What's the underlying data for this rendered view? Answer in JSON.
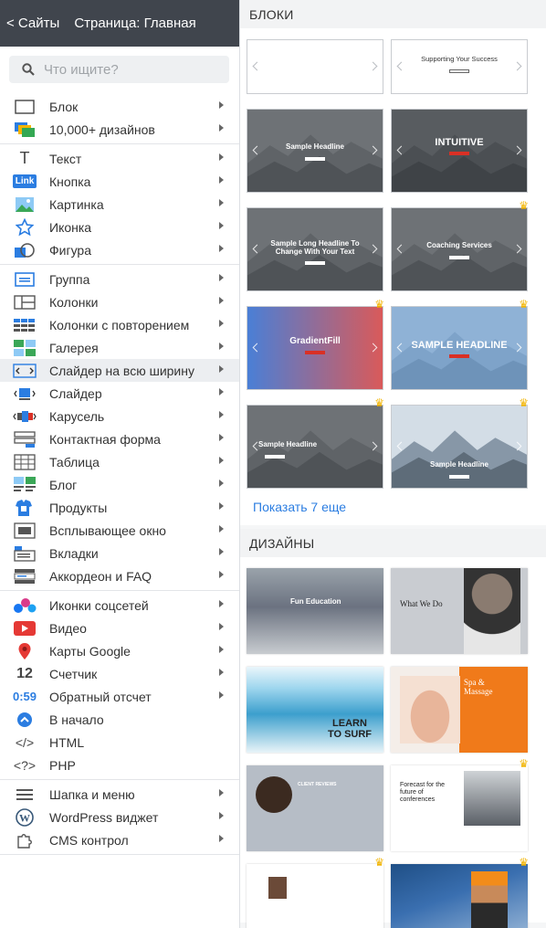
{
  "topbar": {
    "back_label": "< Сайты",
    "page_label": "Страница: Главная"
  },
  "search": {
    "placeholder": "Что ищите?"
  },
  "menu_groups": [
    [
      {
        "label": "Блок",
        "icon": "block-icon"
      },
      {
        "label": "10,000+ дизайнов",
        "icon": "designs-icon"
      }
    ],
    [
      {
        "label": "Текст",
        "icon": "text-icon"
      },
      {
        "label": "Кнопка",
        "icon": "button-icon",
        "badge": "Link"
      },
      {
        "label": "Картинка",
        "icon": "image-icon"
      },
      {
        "label": "Иконка",
        "icon": "star-icon"
      },
      {
        "label": "Фигура",
        "icon": "shape-icon"
      }
    ],
    [
      {
        "label": "Группа",
        "icon": "group-icon"
      },
      {
        "label": "Колонки",
        "icon": "columns-icon"
      },
      {
        "label": "Колонки с повторением",
        "icon": "repeat-columns-icon"
      },
      {
        "label": "Галерея",
        "icon": "gallery-icon"
      },
      {
        "label": "Слайдер на всю ширину",
        "icon": "fullwidth-slider-icon",
        "active": true
      },
      {
        "label": "Слайдер",
        "icon": "slider-icon"
      },
      {
        "label": "Карусель",
        "icon": "carousel-icon"
      },
      {
        "label": "Контактная форма",
        "icon": "form-icon"
      },
      {
        "label": "Таблица",
        "icon": "table-icon"
      },
      {
        "label": "Блог",
        "icon": "blog-icon"
      },
      {
        "label": "Продукты",
        "icon": "products-icon"
      },
      {
        "label": "Всплывающее окно",
        "icon": "popup-icon"
      },
      {
        "label": "Вкладки",
        "icon": "tabs-icon"
      },
      {
        "label": "Аккордеон и FAQ",
        "icon": "accordion-icon"
      }
    ],
    [
      {
        "label": "Иконки соцсетей",
        "icon": "social-icon"
      },
      {
        "label": "Видео",
        "icon": "video-icon"
      },
      {
        "label": "Карты Google",
        "icon": "map-pin-icon"
      },
      {
        "label": "Счетчик",
        "icon": "counter-icon",
        "glyph": "12"
      },
      {
        "label": "Обратный отсчет",
        "icon": "countdown-icon",
        "glyph": "0:59"
      },
      {
        "label": "В начало",
        "icon": "back-to-top-icon"
      },
      {
        "label": "HTML",
        "icon": "html-icon",
        "glyph": "</>"
      },
      {
        "label": "PHP",
        "icon": "php-icon",
        "glyph": "<?>"
      }
    ],
    [
      {
        "label": "Шапка и меню",
        "icon": "hamburger-icon"
      },
      {
        "label": "WordPress виджет",
        "icon": "wordpress-icon"
      },
      {
        "label": "CMS контрол",
        "icon": "puzzle-icon"
      }
    ]
  ],
  "blocks_panel": {
    "heading": "БЛОКИ",
    "thumbs": [
      {
        "title": "",
        "style": "light",
        "crown": false
      },
      {
        "title": "Supporting Your Success",
        "style": "light",
        "crown": false
      },
      {
        "title": "Sample Headline",
        "style": "gray",
        "crown": false
      },
      {
        "title": "INTUITIVE",
        "style": "dark",
        "crown": false
      },
      {
        "title": "Sample Long Headline To Change With Your Text",
        "style": "gray",
        "crown": false
      },
      {
        "title": "Coaching Services",
        "style": "gray",
        "crown": true
      },
      {
        "title": "GradientFill",
        "style": "gradient",
        "crown": true
      },
      {
        "title": "SAMPLE HEADLINE",
        "style": "blue",
        "crown": true
      },
      {
        "title": "Sample Headline",
        "style": "gray",
        "crown": true
      },
      {
        "title": "Sample Headline",
        "style": "lightblue",
        "crown": true
      }
    ],
    "show_more": "Показать 7 еще"
  },
  "designs_panel": {
    "heading": "ДИЗАЙНЫ",
    "thumbs": [
      {
        "title": "Fun Education",
        "crown": false,
        "bg": "#6b7280"
      },
      {
        "title": "What We Do",
        "crown": false,
        "bg": "#c9ccd1"
      },
      {
        "title": "LEARN TO SURF",
        "crown": false,
        "bg": "#7fc4e3"
      },
      {
        "title": "Spa & Massage",
        "crown": false,
        "bg": "#f07a1a"
      },
      {
        "title": "CLIENT REVIEWS",
        "crown": false,
        "bg": "#b6bdc6"
      },
      {
        "title": "Forecast for the future of conferences",
        "crown": true,
        "bg": "#ffffff"
      },
      {
        "title": "",
        "crown": true,
        "bg": "#ffffff"
      },
      {
        "title": "",
        "crown": true,
        "bg": "#3a6fb0"
      }
    ]
  },
  "colors": {
    "accent": "#2b7de1",
    "topbar": "#40454d",
    "crown": "#f2b400"
  }
}
